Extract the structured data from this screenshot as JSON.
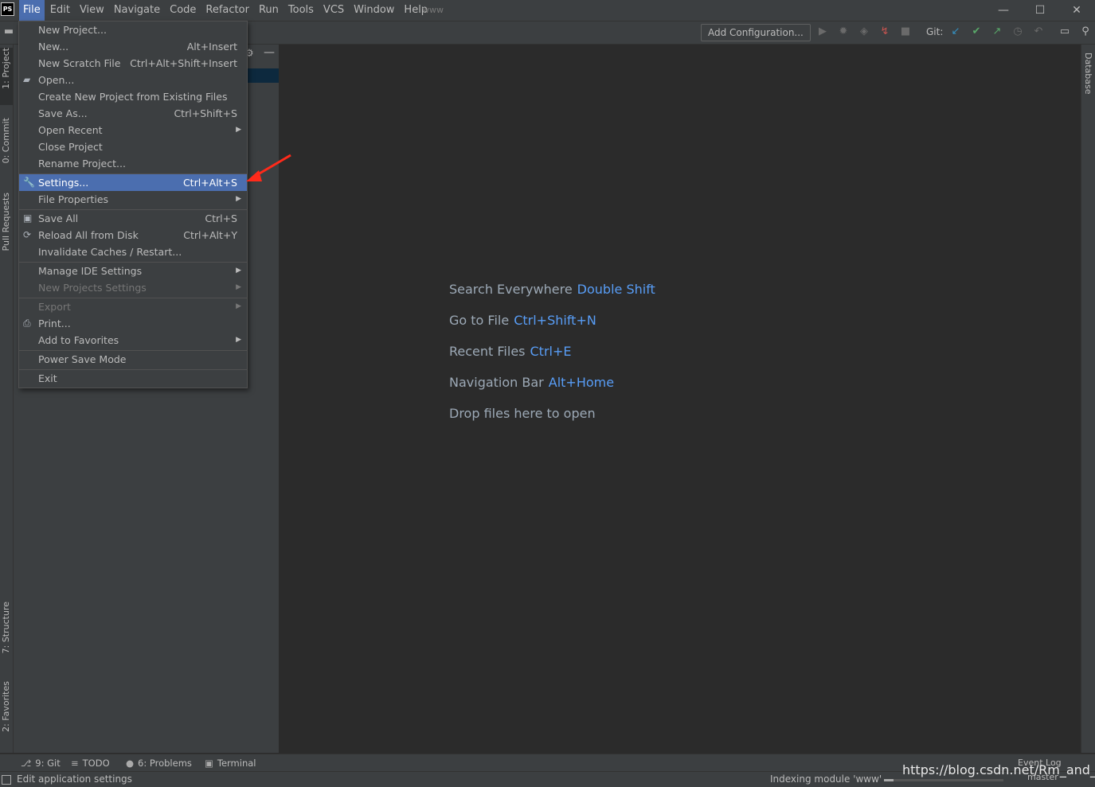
{
  "app": {
    "logo_text": "PS",
    "project_name": "www"
  },
  "menubar": [
    {
      "label": "File",
      "active": true
    },
    {
      "label": "Edit"
    },
    {
      "label": "View"
    },
    {
      "label": "Navigate"
    },
    {
      "label": "Code"
    },
    {
      "label": "Refactor"
    },
    {
      "label": "Run"
    },
    {
      "label": "Tools"
    },
    {
      "label": "VCS"
    },
    {
      "label": "Window"
    },
    {
      "label": "Help"
    }
  ],
  "window_controls": {
    "minimize": "—",
    "maximize": "☐",
    "close": "✕"
  },
  "toolbar": {
    "add_configuration": "Add Configuration...",
    "git_label": "Git:"
  },
  "left_tabs": {
    "project": "1: Project",
    "commit": "0: Commit",
    "pull_requests": "Pull Requests",
    "structure": "7: Structure",
    "favorites": "2: Favorites"
  },
  "right_tabs": {
    "database": "Database"
  },
  "file_menu": [
    {
      "label": "New Project..."
    },
    {
      "label": "New...",
      "shortcut": "Alt+Insert"
    },
    {
      "label": "New Scratch File",
      "shortcut": "Ctrl+Alt+Shift+Insert"
    },
    {
      "label": "Open...",
      "icon": "folder-icon"
    },
    {
      "label": "Create New Project from Existing Files"
    },
    {
      "label": "Save As...",
      "shortcut": "Ctrl+Shift+S"
    },
    {
      "label": "Open Recent",
      "submenu": true
    },
    {
      "label": "Close Project"
    },
    {
      "label": "Rename Project..."
    },
    {
      "label": "Settings...",
      "shortcut": "Ctrl+Alt+S",
      "icon": "wrench-icon",
      "selected": true
    },
    {
      "label": "File Properties",
      "submenu": true
    },
    {
      "label": "Save All",
      "shortcut": "Ctrl+S",
      "icon": "save-icon"
    },
    {
      "label": "Reload All from Disk",
      "shortcut": "Ctrl+Alt+Y",
      "icon": "reload-icon"
    },
    {
      "label": "Invalidate Caches / Restart..."
    },
    {
      "label": "Manage IDE Settings",
      "submenu": true
    },
    {
      "label": "New Projects Settings",
      "submenu": true,
      "disabled": true
    },
    {
      "label": "Export",
      "submenu": true,
      "disabled": true
    },
    {
      "label": "Print...",
      "icon": "print-icon"
    },
    {
      "label": "Add to Favorites",
      "submenu": true
    },
    {
      "label": "Power Save Mode"
    },
    {
      "label": "Exit"
    }
  ],
  "editor_hints": [
    {
      "label": "Search Everywhere",
      "key": "Double Shift"
    },
    {
      "label": "Go to File",
      "key": "Ctrl+Shift+N"
    },
    {
      "label": "Recent Files",
      "key": "Ctrl+E"
    },
    {
      "label": "Navigation Bar",
      "key": "Alt+Home"
    },
    {
      "label": "Drop files here to open",
      "key": ""
    }
  ],
  "bottom_tabs": {
    "git": "9: Git",
    "todo": "TODO",
    "problems": "6: Problems",
    "terminal": "Terminal"
  },
  "status": {
    "text": "Edit application settings",
    "indexing": "Indexing module 'www'",
    "indexing_progress": 0.08,
    "event_log": "Event Log",
    "branch": "master"
  },
  "watermark": "https://blog.csdn.net/Rm_and_Rf",
  "colors": {
    "accent": "#4b6eaf",
    "key_blue": "#589df6",
    "arrow_red": "#ff2a1a"
  }
}
